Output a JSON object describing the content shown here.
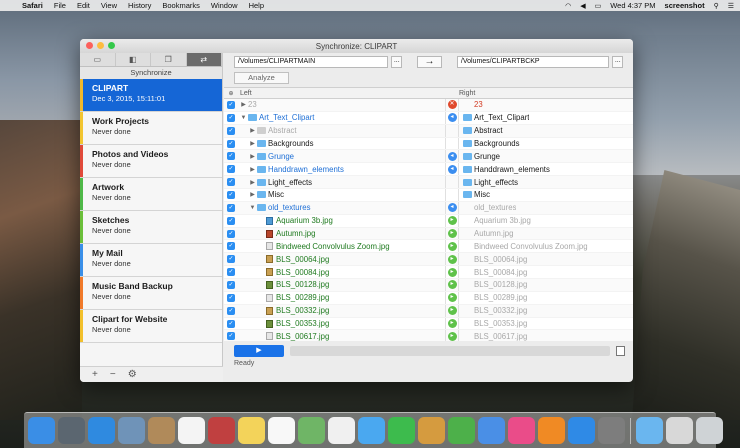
{
  "menubar": {
    "apple": "",
    "app": "Safari",
    "items": [
      "File",
      "Edit",
      "View",
      "History",
      "Bookmarks",
      "Window",
      "Help"
    ],
    "clock": "Wed 4:37 PM",
    "user": "screenshot"
  },
  "window": {
    "title": "Synchronize: CLIPART"
  },
  "sidebar": {
    "caption": "Synchronize",
    "jobs": [
      {
        "name": "CLIPART",
        "sub": "Dec 3, 2015, 15:11:01",
        "color": "#f2b92b"
      },
      {
        "name": "Work Projects",
        "sub": "Never done",
        "color": "#f2c530"
      },
      {
        "name": "Photos and Videos",
        "sub": "Never done",
        "color": "#e04a3a"
      },
      {
        "name": "Artwork",
        "sub": "Never done",
        "color": "#4fb848"
      },
      {
        "name": "Sketches",
        "sub": "Never done",
        "color": "#6bbf3a"
      },
      {
        "name": "My Mail",
        "sub": "Never done",
        "color": "#3a8fe8"
      },
      {
        "name": "Music Band Backup",
        "sub": "Never done",
        "color": "#f07a2a"
      },
      {
        "name": "Clipart for Website",
        "sub": "Never done",
        "color": "#f2c02c"
      }
    ],
    "add": "+",
    "remove": "−",
    "settings": "⚙"
  },
  "main": {
    "left_path": "/Volumes/CLIPARTMAIN",
    "right_path": "/Volumes/CLIPARTBCKP",
    "browse": "...",
    "analyze": "Analyze",
    "col_left": "Left",
    "col_right": "Right",
    "status": "Ready"
  },
  "rows": [
    {
      "left": "23",
      "right": "23",
      "indent": 0,
      "tri": "▶",
      "icon": "none",
      "lstyle": "t-gray",
      "rstyle": "t-red",
      "act": "red",
      "actglyph": "✕",
      "ricon": "none"
    },
    {
      "left": "Art_Text_Clipart",
      "right": "Art_Text_Clipart",
      "indent": 0,
      "tri": "▼",
      "icon": "fold",
      "lstyle": "t-blue",
      "rstyle": "t-dark",
      "act": "blue",
      "actglyph": "◂",
      "ricon": "fold"
    },
    {
      "left": "Abstract",
      "right": "Abstract",
      "indent": 1,
      "tri": "▶",
      "icon": "foldgray",
      "lstyle": "t-gray",
      "rstyle": "t-dark",
      "act": "",
      "actglyph": "",
      "ricon": "fold"
    },
    {
      "left": "Backgrounds",
      "right": "Backgrounds",
      "indent": 1,
      "tri": "▶",
      "icon": "fold",
      "lstyle": "t-dark",
      "rstyle": "t-dark",
      "act": "",
      "actglyph": "",
      "ricon": "fold"
    },
    {
      "left": "Grunge",
      "right": "Grunge",
      "indent": 1,
      "tri": "▶",
      "icon": "fold",
      "lstyle": "t-blue",
      "rstyle": "t-dark",
      "act": "blue",
      "actglyph": "◂",
      "ricon": "fold"
    },
    {
      "left": "Handdrawn_elements",
      "right": "Handdrawn_elements",
      "indent": 1,
      "tri": "▶",
      "icon": "fold",
      "lstyle": "t-blue",
      "rstyle": "t-dark",
      "act": "blue",
      "actglyph": "◂",
      "ricon": "fold"
    },
    {
      "left": "Light_effects",
      "right": "Light_effects",
      "indent": 1,
      "tri": "▶",
      "icon": "fold",
      "lstyle": "t-dark",
      "rstyle": "t-dark",
      "act": "",
      "actglyph": "",
      "ricon": "fold"
    },
    {
      "left": "Misc",
      "right": "Misc",
      "indent": 1,
      "tri": "▶",
      "icon": "fold",
      "lstyle": "t-dark",
      "rstyle": "t-dark",
      "act": "",
      "actglyph": "",
      "ricon": "fold"
    },
    {
      "left": "old_textures",
      "right": "old_textures",
      "indent": 1,
      "tri": "▼",
      "icon": "fold",
      "lstyle": "t-blue",
      "rstyle": "t-gray",
      "act": "blue",
      "actglyph": "◂",
      "ricon": "none"
    },
    {
      "left": "Aquarium 3b.jpg",
      "right": "Aquarium 3b.jpg",
      "indent": 2,
      "tri": "",
      "icon": "img1",
      "lstyle": "t-green",
      "rstyle": "t-gray",
      "act": "green",
      "actglyph": "▸",
      "ricon": "none"
    },
    {
      "left": "Autumn.jpg",
      "right": "Autumn.jpg",
      "indent": 2,
      "tri": "",
      "icon": "img2",
      "lstyle": "t-green",
      "rstyle": "t-gray",
      "act": "green",
      "actglyph": "▸",
      "ricon": "none"
    },
    {
      "left": "Bindweed Convolvulus Zoom.jpg",
      "right": "Bindweed Convolvulus Zoom.jpg",
      "indent": 2,
      "tri": "",
      "icon": "file",
      "lstyle": "t-green",
      "rstyle": "t-gray",
      "act": "green",
      "actglyph": "▸",
      "ricon": "none"
    },
    {
      "left": "BLS_00064.jpg",
      "right": "BLS_00064.jpg",
      "indent": 2,
      "tri": "",
      "icon": "img3",
      "lstyle": "t-green",
      "rstyle": "t-gray",
      "act": "green",
      "actglyph": "▸",
      "ricon": "none"
    },
    {
      "left": "BLS_00084.jpg",
      "right": "BLS_00084.jpg",
      "indent": 2,
      "tri": "",
      "icon": "img3",
      "lstyle": "t-green",
      "rstyle": "t-gray",
      "act": "green",
      "actglyph": "▸",
      "ricon": "none"
    },
    {
      "left": "BLS_00128.jpg",
      "right": "BLS_00128.jpg",
      "indent": 2,
      "tri": "",
      "icon": "img4",
      "lstyle": "t-green",
      "rstyle": "t-gray",
      "act": "green",
      "actglyph": "▸",
      "ricon": "none"
    },
    {
      "left": "BLS_00289.jpg",
      "right": "BLS_00289.jpg",
      "indent": 2,
      "tri": "",
      "icon": "file",
      "lstyle": "t-green",
      "rstyle": "t-gray",
      "act": "green",
      "actglyph": "▸",
      "ricon": "none"
    },
    {
      "left": "BLS_00332.jpg",
      "right": "BLS_00332.jpg",
      "indent": 2,
      "tri": "",
      "icon": "img3",
      "lstyle": "t-green",
      "rstyle": "t-gray",
      "act": "green",
      "actglyph": "▸",
      "ricon": "none"
    },
    {
      "left": "BLS_00353.jpg",
      "right": "BLS_00353.jpg",
      "indent": 2,
      "tri": "",
      "icon": "img4",
      "lstyle": "t-green",
      "rstyle": "t-gray",
      "act": "green",
      "actglyph": "▸",
      "ricon": "none"
    },
    {
      "left": "BLS_00617.jpg",
      "right": "BLS_00617.jpg",
      "indent": 2,
      "tri": "",
      "icon": "file",
      "lstyle": "t-green",
      "rstyle": "t-gray",
      "act": "green",
      "actglyph": "▸",
      "ricon": "none"
    }
  ],
  "dock": [
    {
      "name": "finder-icon",
      "color": "#3a8ee6"
    },
    {
      "name": "launchpad-icon",
      "color": "#5b6670"
    },
    {
      "name": "safari-icon",
      "color": "#2f8ae0"
    },
    {
      "name": "preview-icon",
      "color": "#6f93b8"
    },
    {
      "name": "contacts-icon",
      "color": "#b08a5a"
    },
    {
      "name": "calendar-icon",
      "color": "#f4f4f4"
    },
    {
      "name": "photobooth-icon",
      "color": "#c04040"
    },
    {
      "name": "notes-icon",
      "color": "#f3d35a"
    },
    {
      "name": "reminders-icon",
      "color": "#f8f8f8"
    },
    {
      "name": "maps-icon",
      "color": "#6fb566"
    },
    {
      "name": "photos-icon",
      "color": "#f0f0f0"
    },
    {
      "name": "messages-icon",
      "color": "#4aa8f0"
    },
    {
      "name": "facetime-icon",
      "color": "#3dbb4d"
    },
    {
      "name": "script-editor-icon",
      "color": "#d59b3f"
    },
    {
      "name": "numbers-icon",
      "color": "#4db04a"
    },
    {
      "name": "keynote-icon",
      "color": "#4a8fe6"
    },
    {
      "name": "itunes-icon",
      "color": "#ea4c89"
    },
    {
      "name": "ibooks-icon",
      "color": "#f08a24"
    },
    {
      "name": "appstore-icon",
      "color": "#2f8ae6"
    },
    {
      "name": "system-preferences-icon",
      "color": "#7d7d7d"
    },
    {
      "name": "folder-icon",
      "color": "#6ab6ef"
    },
    {
      "name": "downloads-icon",
      "color": "#d8d8d8"
    },
    {
      "name": "trash-icon",
      "color": "#cfd3d6"
    }
  ]
}
